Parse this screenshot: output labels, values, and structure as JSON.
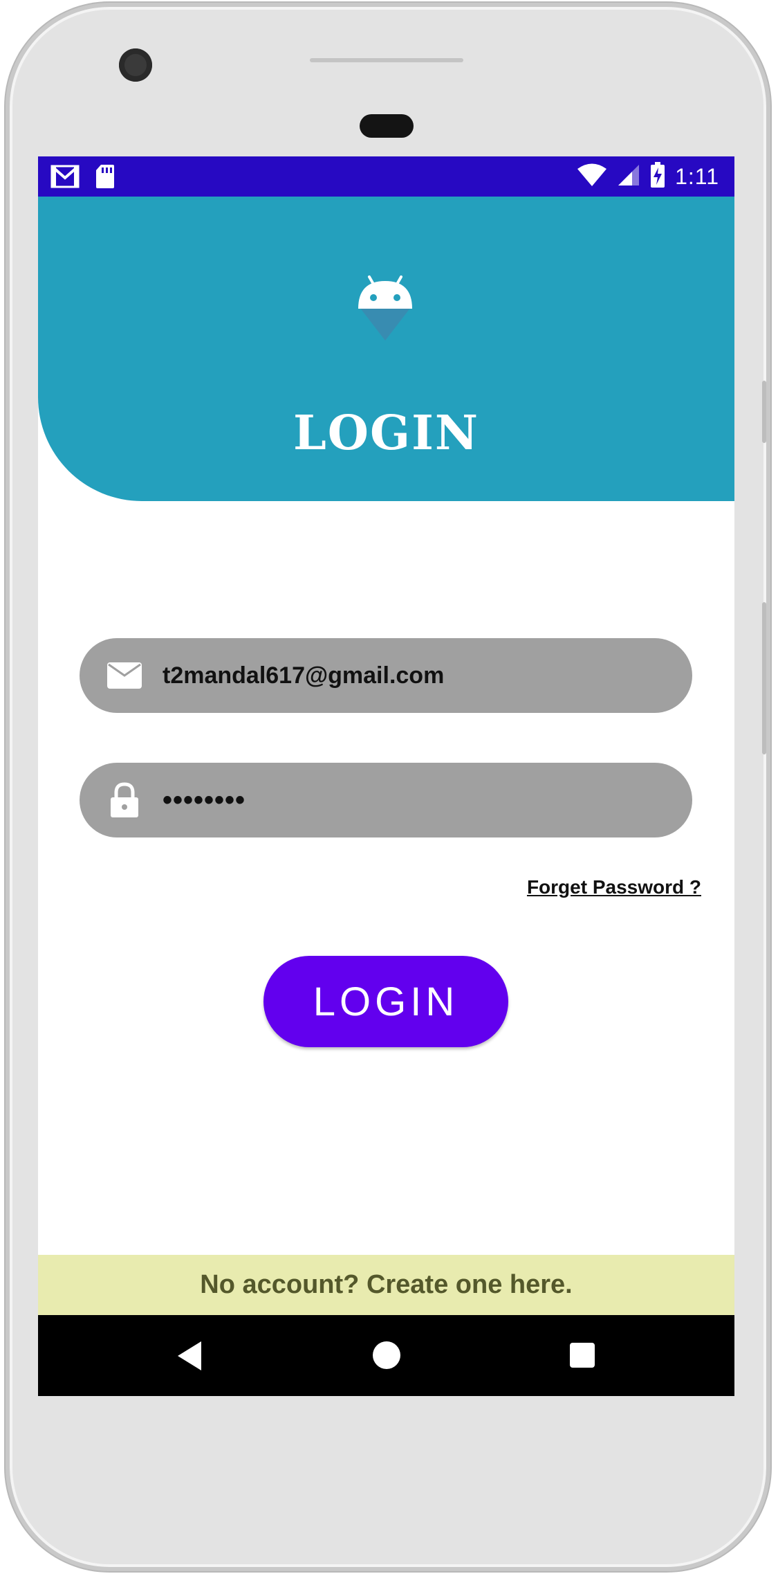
{
  "status_bar": {
    "time": "1:11",
    "left_icons": [
      "gmail-icon",
      "sd-card-icon"
    ],
    "right_icons": [
      "wifi-icon",
      "cell-signal-icon",
      "battery-charging-icon"
    ],
    "color": "#2709c2"
  },
  "header": {
    "title": "LOGIN",
    "logo_icon": "android-icon",
    "color": "#24a0bd"
  },
  "form": {
    "email": {
      "value": "t2mandal617@gmail.com",
      "icon": "mail-icon"
    },
    "password": {
      "value": "••••••••",
      "icon": "lock-icon"
    },
    "forgot_label": "Forget Password ?",
    "login_label": "LOGIN",
    "login_color": "#6200ee"
  },
  "footer": {
    "signup_label": "No account? Create one here.",
    "color": "#e8ebaf"
  },
  "nav_bar": {
    "icons": [
      "back-icon",
      "home-icon",
      "recents-icon"
    ]
  }
}
